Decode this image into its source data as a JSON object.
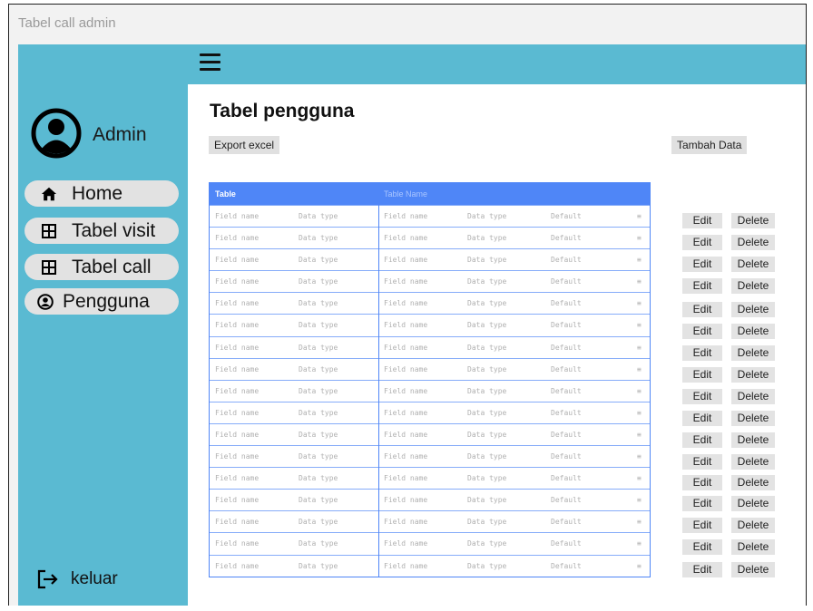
{
  "window": {
    "title": "Tabel call admin"
  },
  "sidebar": {
    "user_name": "Admin",
    "items": [
      {
        "label": "Home",
        "icon": "home-icon"
      },
      {
        "label": "Tabel visit",
        "icon": "grid-icon"
      },
      {
        "label": "Tabel call",
        "icon": "grid-icon"
      },
      {
        "label": "Pengguna",
        "icon": "user-circle-icon"
      }
    ],
    "logout_label": "keluar"
  },
  "main": {
    "title": "Tabel pengguna",
    "export_label": "Export excel",
    "add_label": "Tambah Data"
  },
  "table": {
    "header_left": "Table",
    "header_right": "Table Name",
    "row_cells": [
      "Field name",
      "Data type",
      "Field name",
      "Data type",
      "Default",
      "≡"
    ],
    "row_count": 17
  },
  "actions": {
    "edit_label": "Edit",
    "delete_label": "Delete"
  },
  "colors": {
    "sidebar": "#5abad2",
    "table_accent": "#4f86f7",
    "button_gray": "#e0e0e0"
  }
}
